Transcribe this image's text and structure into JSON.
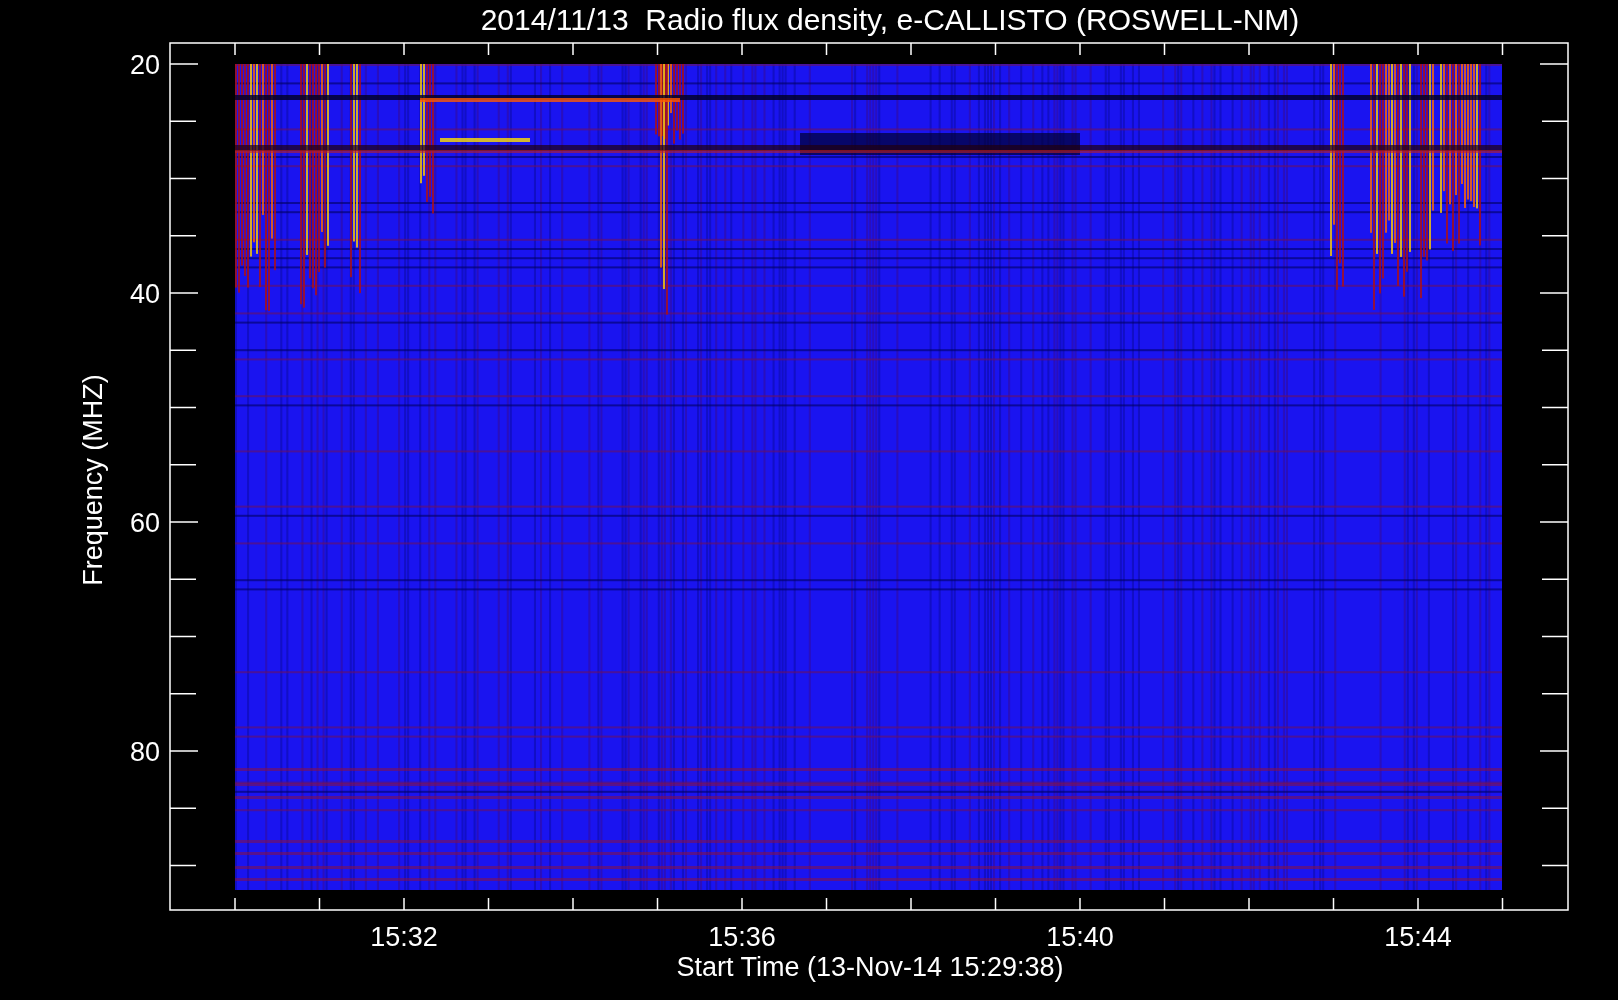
{
  "plot": {
    "title": "2014/11/13  Radio flux density, e-CALLISTO (ROSWELL-NM)",
    "ylabel": "Frequency (MHZ)",
    "xlabel": "Start Time (13-Nov-14 15:29:38)",
    "yticks": [
      "20",
      "40",
      "60",
      "80"
    ],
    "xticks": [
      "15:32",
      "15:36",
      "15:40",
      "15:44"
    ]
  }
}
